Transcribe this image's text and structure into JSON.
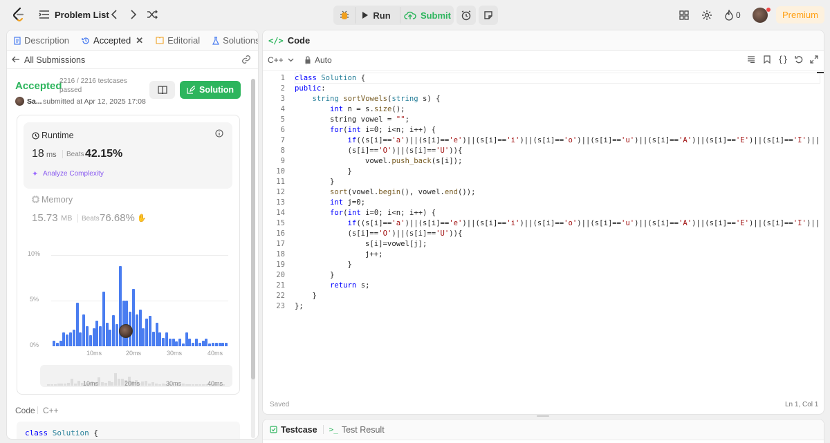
{
  "topbar": {
    "problem_list": "Problem List",
    "run": "Run",
    "submit": "Submit",
    "streak": "0",
    "premium": "Premium"
  },
  "left_tabs": [
    {
      "label": "Description"
    },
    {
      "label": "Accepted"
    },
    {
      "label": "Editorial"
    },
    {
      "label": "Solutions"
    }
  ],
  "submissions": {
    "back": "All Submissions",
    "status": "Accepted",
    "testcases": "2216 / 2216 testcases",
    "passed": "passed",
    "user": "Sa...",
    "submitted": "submitted at Apr 12, 2025 17:08",
    "solution_btn": "Solution"
  },
  "runtime": {
    "title": "Runtime",
    "value": "18",
    "unit": "ms",
    "beats_label": "Beats",
    "beats": "42.15%",
    "analyze": "Analyze Complexity"
  },
  "memory": {
    "title": "Memory",
    "value": "15.73",
    "unit": "MB",
    "beats_label": "Beats",
    "beats": "76.68%"
  },
  "chart_data": {
    "type": "bar",
    "y_ticks": [
      "10%",
      "5%",
      "0%"
    ],
    "x_ticks": [
      "10ms",
      "20ms",
      "30ms",
      "40ms"
    ],
    "ylim": [
      0,
      10
    ],
    "values": [
      0.6,
      0.4,
      0.6,
      1.5,
      1.3,
      1.5,
      1.8,
      4.8,
      1.5,
      3.5,
      2.2,
      1.2,
      2.0,
      2.8,
      2.2,
      6.0,
      2.6,
      1.8,
      3.4,
      2.4,
      8.8,
      5.0,
      5.0,
      3.8,
      6.3,
      3.5,
      4.0,
      2.0,
      3.0,
      3.3,
      1.6,
      2.6,
      1.5,
      0.9,
      1.5,
      0.8,
      0.8,
      0.5,
      0.8,
      0.3,
      1.5,
      0.8,
      0.4,
      0.8,
      0.4,
      0.6,
      0.8,
      0.3,
      0.4,
      0.4,
      0.4,
      0.4,
      0.4
    ],
    "mini_ticks": [
      "10ms",
      "20ms",
      "30ms",
      "40ms"
    ]
  },
  "code_footer": {
    "label": "Code",
    "lang": "C++",
    "preview": "class Solution {"
  },
  "editor": {
    "title": "Code",
    "lang": "C++",
    "mode": "Auto",
    "saved": "Saved",
    "cursor": "Ln 1, Col 1",
    "line_numbers": [
      "1",
      "2",
      "3",
      "4",
      "5",
      "6",
      "7",
      "8",
      "9",
      "10",
      "11",
      "12",
      "13",
      "14",
      "15",
      "16",
      "17",
      "18",
      "19",
      "20",
      "21",
      "22",
      "23"
    ]
  },
  "bottom_tabs": {
    "testcase": "Testcase",
    "result": "Test Result"
  },
  "colors": {
    "accent_green": "#2db55d",
    "accent_blue": "#4a7df0",
    "premium": "#ffa116"
  }
}
